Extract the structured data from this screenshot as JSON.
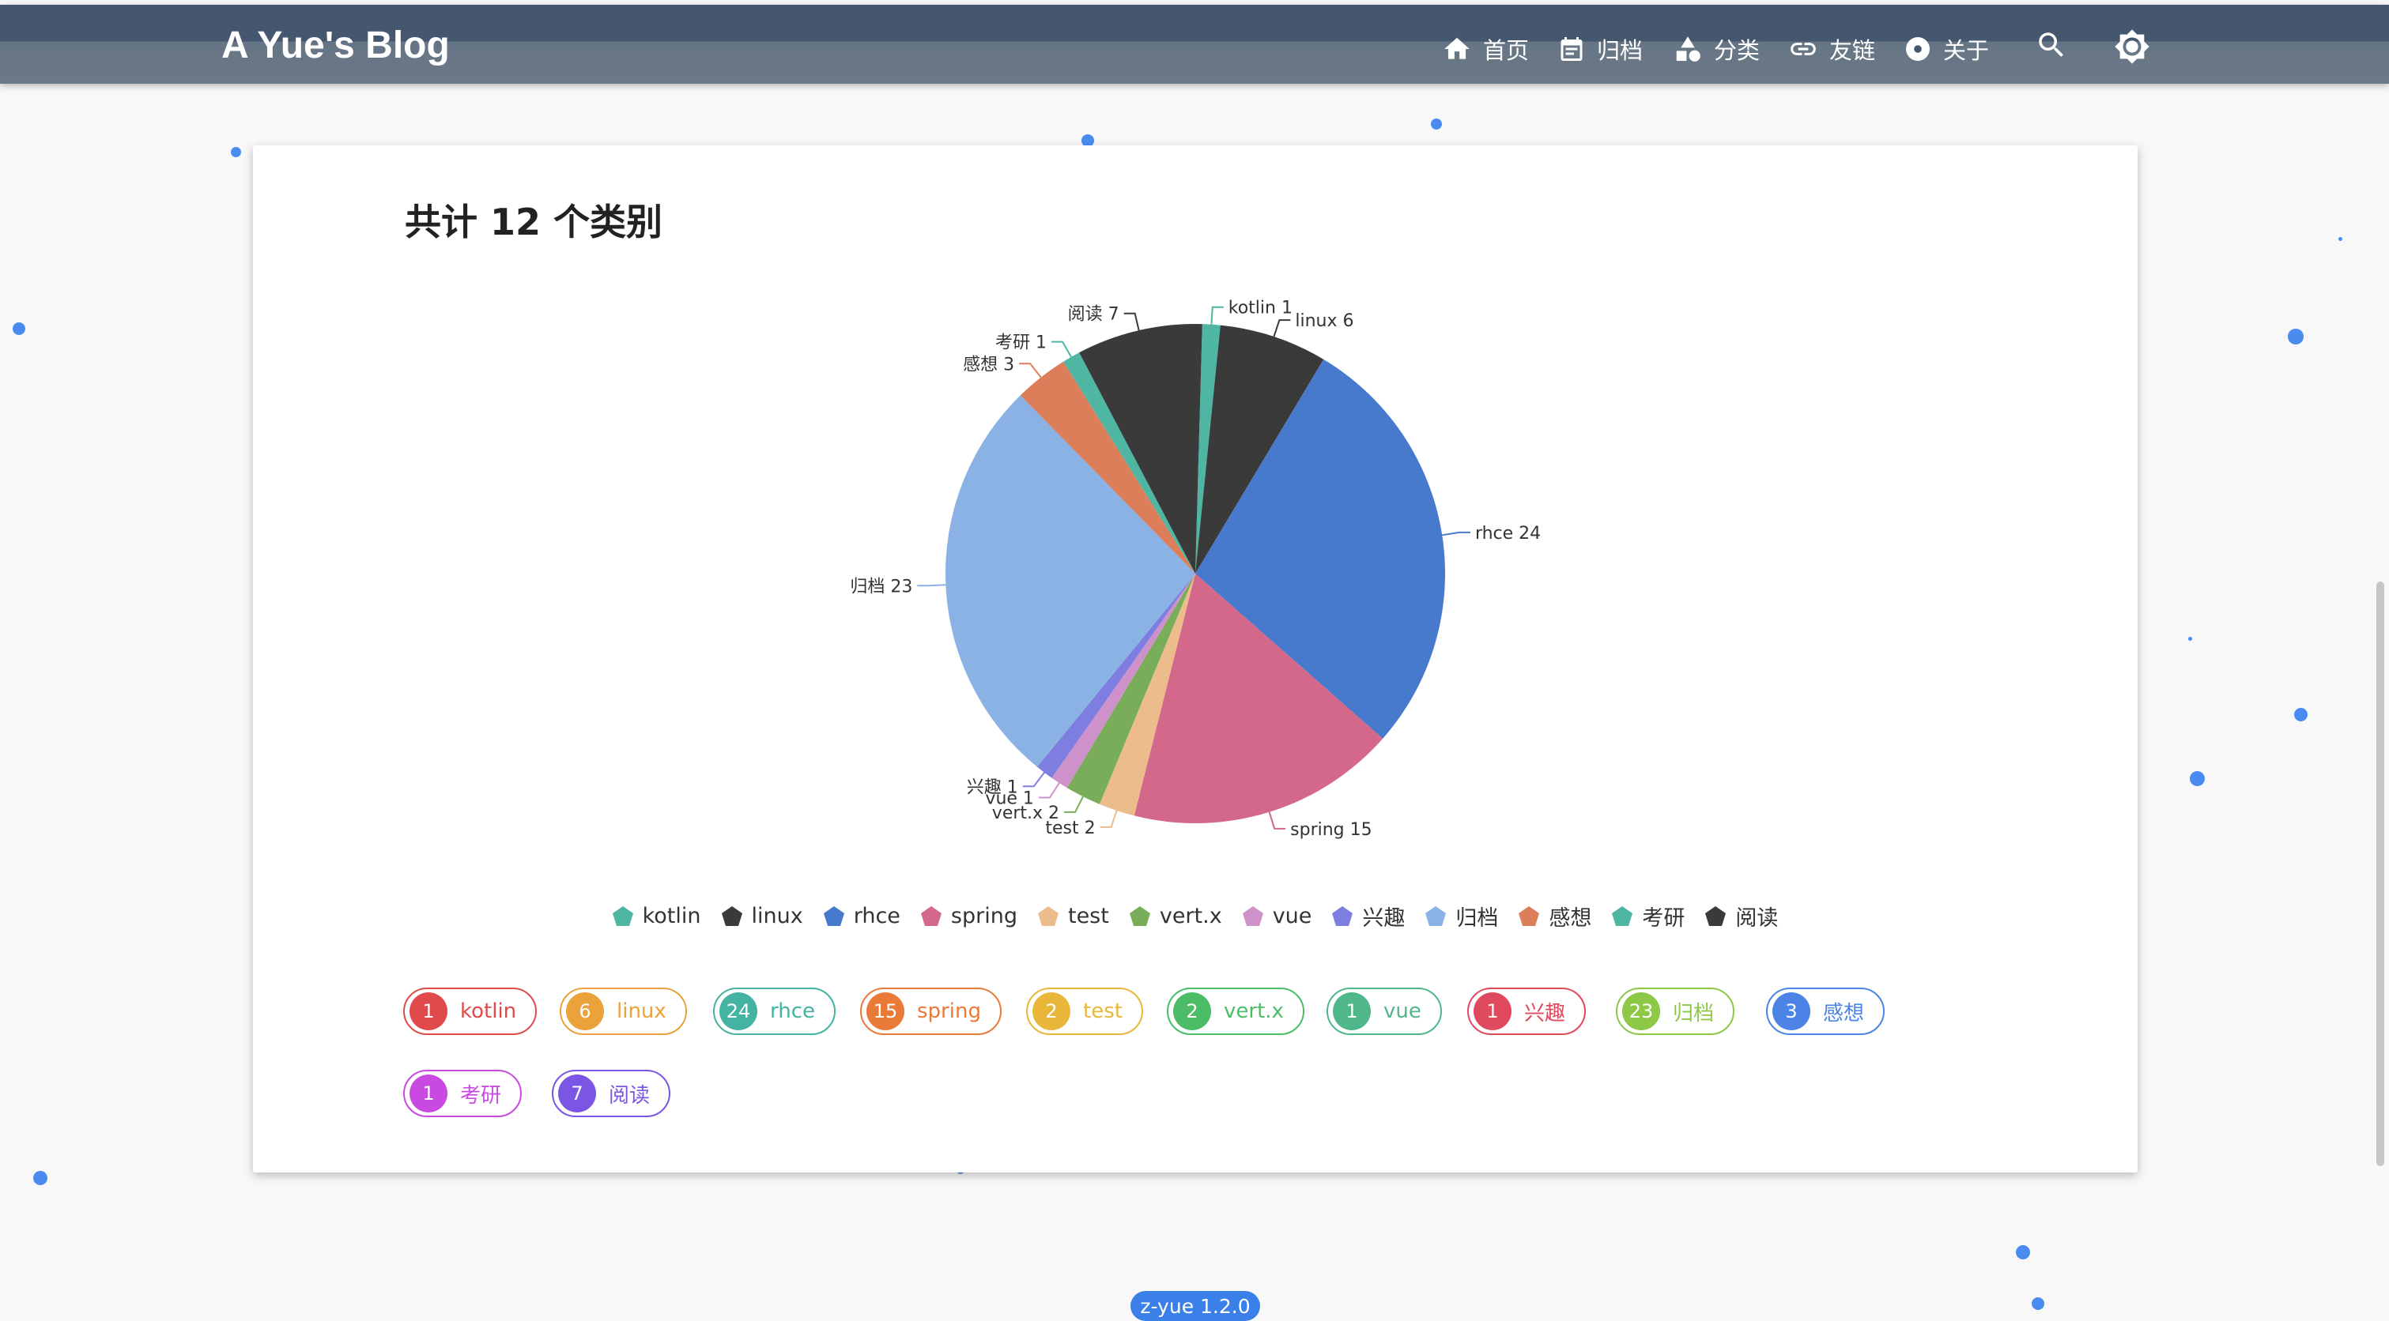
{
  "header": {
    "brand": "A Yue's Blog",
    "nav": [
      {
        "label": "首页",
        "icon": "home-icon"
      },
      {
        "label": "归档",
        "icon": "calendar-icon"
      },
      {
        "label": "分类",
        "icon": "shapes-icon"
      },
      {
        "label": "友链",
        "icon": "link-icon"
      },
      {
        "label": "关于",
        "icon": "disc-icon"
      }
    ],
    "search_icon": "search-icon",
    "theme_icon": "brightness-icon"
  },
  "page": {
    "title": "共计 12 个类别"
  },
  "chart_data": {
    "type": "pie",
    "categories": [
      "kotlin",
      "linux",
      "rhce",
      "spring",
      "test",
      "vert.x",
      "vue",
      "兴趣",
      "归档",
      "感想",
      "考研",
      "阅读"
    ],
    "values": [
      1,
      6,
      24,
      15,
      2,
      2,
      1,
      1,
      23,
      3,
      1,
      7
    ],
    "colors": [
      "#4fb6a3",
      "#3a3a3a",
      "#4779cc",
      "#d4688b",
      "#ecbc8d",
      "#7aad59",
      "#cf91c9",
      "#7d7ee0",
      "#8ab2e5",
      "#dd7e5b",
      "#4fb6a3",
      "#3a3a3a"
    ],
    "legend_position": "bottom"
  },
  "tags": [
    {
      "count": "1",
      "name": "kotlin",
      "color": "#e04a4a"
    },
    {
      "count": "6",
      "name": "linux",
      "color": "#eba23a"
    },
    {
      "count": "24",
      "name": "rhce",
      "color": "#44b3a1"
    },
    {
      "count": "15",
      "name": "spring",
      "color": "#ea7a38"
    },
    {
      "count": "2",
      "name": "test",
      "color": "#e8b73a"
    },
    {
      "count": "2",
      "name": "vert.x",
      "color": "#4cbd66"
    },
    {
      "count": "1",
      "name": "vue",
      "color": "#4fb789"
    },
    {
      "count": "1",
      "name": "兴趣",
      "color": "#e04a5e"
    },
    {
      "count": "23",
      "name": "归档",
      "color": "#8dc846"
    },
    {
      "count": "3",
      "name": "感想",
      "color": "#4b84e6"
    },
    {
      "count": "1",
      "name": "考研",
      "color": "#c84ae0"
    },
    {
      "count": "7",
      "name": "阅读",
      "color": "#7b55e4"
    }
  ],
  "footer": {
    "version": "z-yue 1.2.0"
  }
}
